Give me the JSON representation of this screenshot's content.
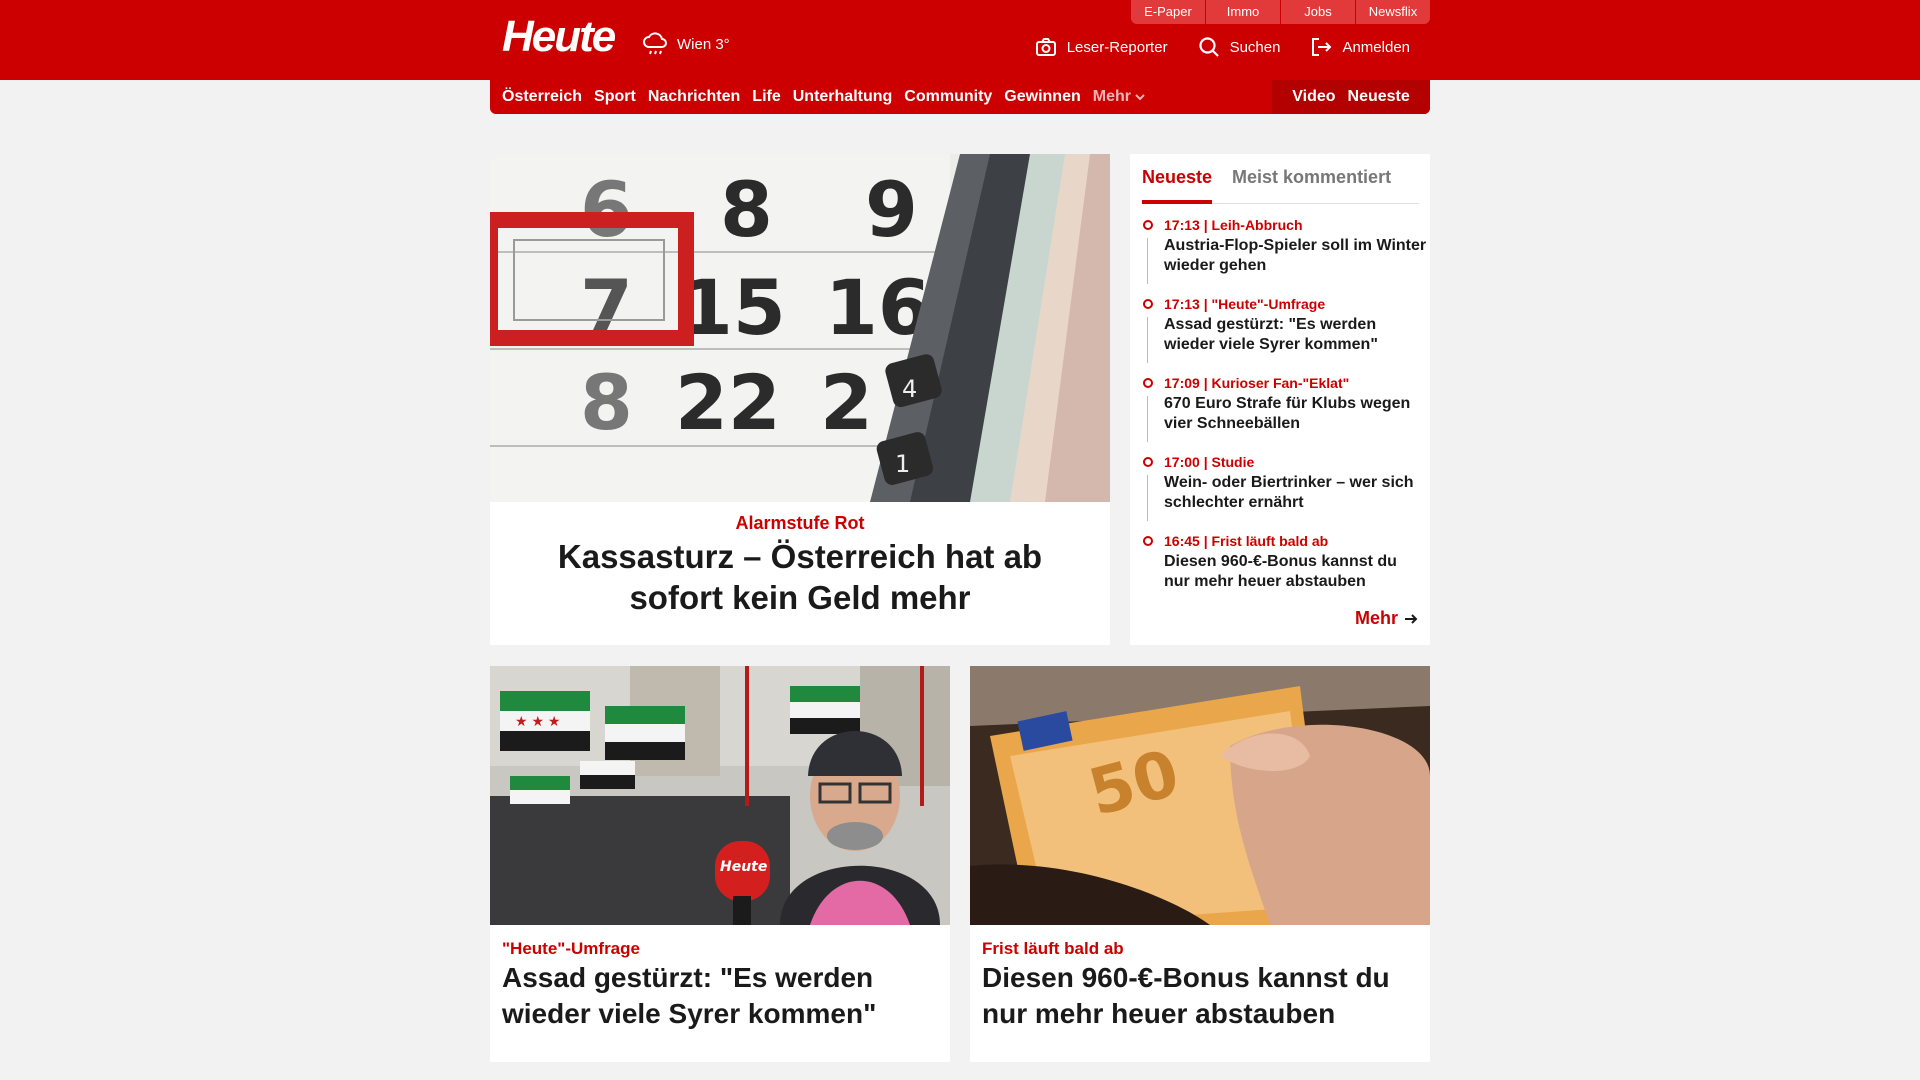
{
  "header": {
    "logo": "Heute",
    "weather": "Wien 3°",
    "services": [
      "E-Paper",
      "Immo",
      "Jobs",
      "Newsflix"
    ],
    "actions": {
      "reporter": "Leser-Reporter",
      "search": "Suchen",
      "login": "Anmelden"
    },
    "icons": [
      "rain-cloud-icon",
      "camera-icon",
      "search-icon",
      "login-icon"
    ]
  },
  "nav": {
    "items": [
      "Österreich",
      "Sport",
      "Nachrichten",
      "Life",
      "Unterhaltung",
      "Community",
      "Gewinnen"
    ],
    "more": "Mehr",
    "video": "Video",
    "latest": "Neueste"
  },
  "hero": {
    "kicker": "Alarmstufe Rot",
    "title": "Kassasturz – Österreich hat ab sofort kein Geld mehr"
  },
  "sidebar": {
    "tabs": [
      "Neueste",
      "Meist kommentiert"
    ],
    "items": [
      {
        "meta": "17:13 | Leih-Abbruch",
        "headline": "Austria-Flop-Spieler soll im Winter wieder gehen"
      },
      {
        "meta": "17:13 | \"Heute\"-Umfrage",
        "headline": "Assad gestürzt: \"Es werden wieder viele Syrer kommen\""
      },
      {
        "meta": "17:09 | Kurioser Fan-\"Eklat\"",
        "headline": "670 Euro Strafe für Klubs wegen vier Schneebällen"
      },
      {
        "meta": "17:00 | Studie",
        "headline": "Wein- oder Biertrinker – wer sich schlechter ernährt"
      },
      {
        "meta": "16:45 | Frist läuft bald ab",
        "headline": "Diesen 960-€-Bonus kannst du nur mehr heuer abstauben"
      }
    ],
    "more": "Mehr"
  },
  "cards": [
    {
      "kicker": "\"Heute\"-Umfrage",
      "title": "Assad gestürzt: \"Es werden wieder viele Syrer kommen\""
    },
    {
      "kicker": "Frist läuft bald ab",
      "title": "Diesen 960-€-Bonus kannst du nur mehr heuer abstauben"
    }
  ],
  "colors": {
    "brand": "#cc0000",
    "background": "#f2f2f2"
  }
}
